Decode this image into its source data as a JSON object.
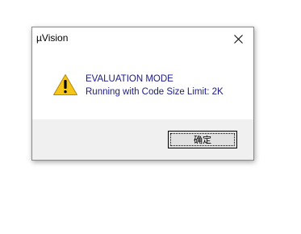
{
  "dialog": {
    "title": "µVision",
    "close_icon": "close-icon",
    "icon": "warning-icon",
    "message_line1": "EVALUATION MODE",
    "message_line2": "Running with Code Size Limit: 2K",
    "ok_label": "确定"
  },
  "colors": {
    "message_text": "#1a1a8c",
    "footer_bg": "#f0f0f0",
    "warning_fill": "#f5c518",
    "button_bg": "#e1e1e1"
  }
}
